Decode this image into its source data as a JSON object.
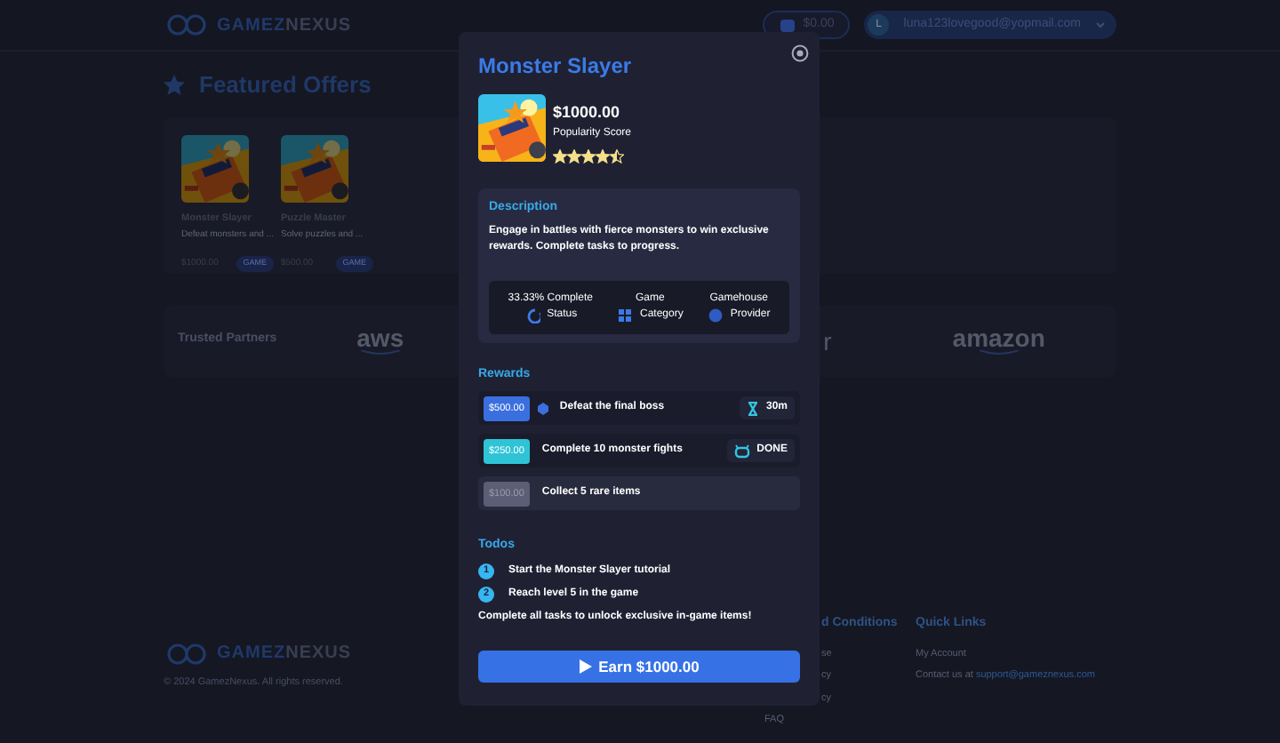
{
  "header": {
    "logo_left": "GAMEZ",
    "logo_right": "NEXUS",
    "wallet": "$0.00",
    "avatar": "L",
    "email": "luna123lovegood@yopmail.com"
  },
  "featured": {
    "title": "Featured Offers",
    "cards": [
      {
        "title": "Monster Slayer",
        "description": "Defeat monsters and ...",
        "price": "$1000.00",
        "tag": "GAME"
      },
      {
        "title": "Puzzle Master",
        "description": "Solve puzzles and ...",
        "price": "$500.00",
        "tag": "GAME"
      }
    ]
  },
  "partners": {
    "title": "Trusted Partners",
    "logos": [
      {
        "kind": "aws",
        "text": "aws"
      },
      {
        "kind": "partial",
        "text": "r"
      },
      {
        "kind": "amazon",
        "text": "amazon"
      }
    ]
  },
  "footer": {
    "logo_left": "GAMEZ",
    "logo_right": "NEXUS",
    "copyright": "© 2024 GamezNexus. All rights reserved.",
    "columns": [
      {
        "title": "d Conditions",
        "kind": "partial",
        "links": [
          {
            "text": "se"
          },
          {
            "text": "cy"
          },
          {
            "text": "cy"
          },
          {
            "text": "FAQ"
          }
        ]
      },
      {
        "title": "Quick Links",
        "kind": "full",
        "links": [
          {
            "text": "My Account"
          },
          {
            "text": "Contact us at",
            "link": "support@gameznexus.com"
          }
        ]
      }
    ]
  },
  "modal": {
    "title": "Monster Slayer",
    "price": "$1000.00",
    "score_label": "Popularity Score",
    "stars": 4.5,
    "description": {
      "heading": "Description",
      "text": "Engage in battles with fierce monsters to win exclusive rewards. Complete tasks to progress."
    },
    "stats": [
      {
        "kind": "status",
        "value": "33.33% Complete",
        "label": "Status"
      },
      {
        "kind": "category",
        "value": "Game",
        "label": "Category"
      },
      {
        "kind": "provider",
        "value": "Gamehouse",
        "label": "Provider"
      }
    ],
    "rewards_title": "Rewards",
    "rewards": [
      {
        "amount": "$500.00",
        "title": "Defeat the final boss",
        "color": "#3b6fe0",
        "kind": "timer",
        "status_text": "30m"
      },
      {
        "amount": "$250.00",
        "title": "Complete 10 monster fights",
        "color": "#2ec4d6",
        "kind": "done",
        "status_text": "DONE"
      },
      {
        "amount": "$100.00",
        "title": "Collect 5 rare items",
        "color": "#5b5e75",
        "kind": "locked"
      }
    ],
    "todos_title": "Todos",
    "todos": [
      {
        "number": "1",
        "text": "Start the Monster Slayer tutorial"
      },
      {
        "number": "2",
        "text": "Reach level 5 in the game"
      }
    ],
    "note": "Complete all tasks to unlock exclusive in-game items!",
    "button": "Earn $1000.00"
  }
}
